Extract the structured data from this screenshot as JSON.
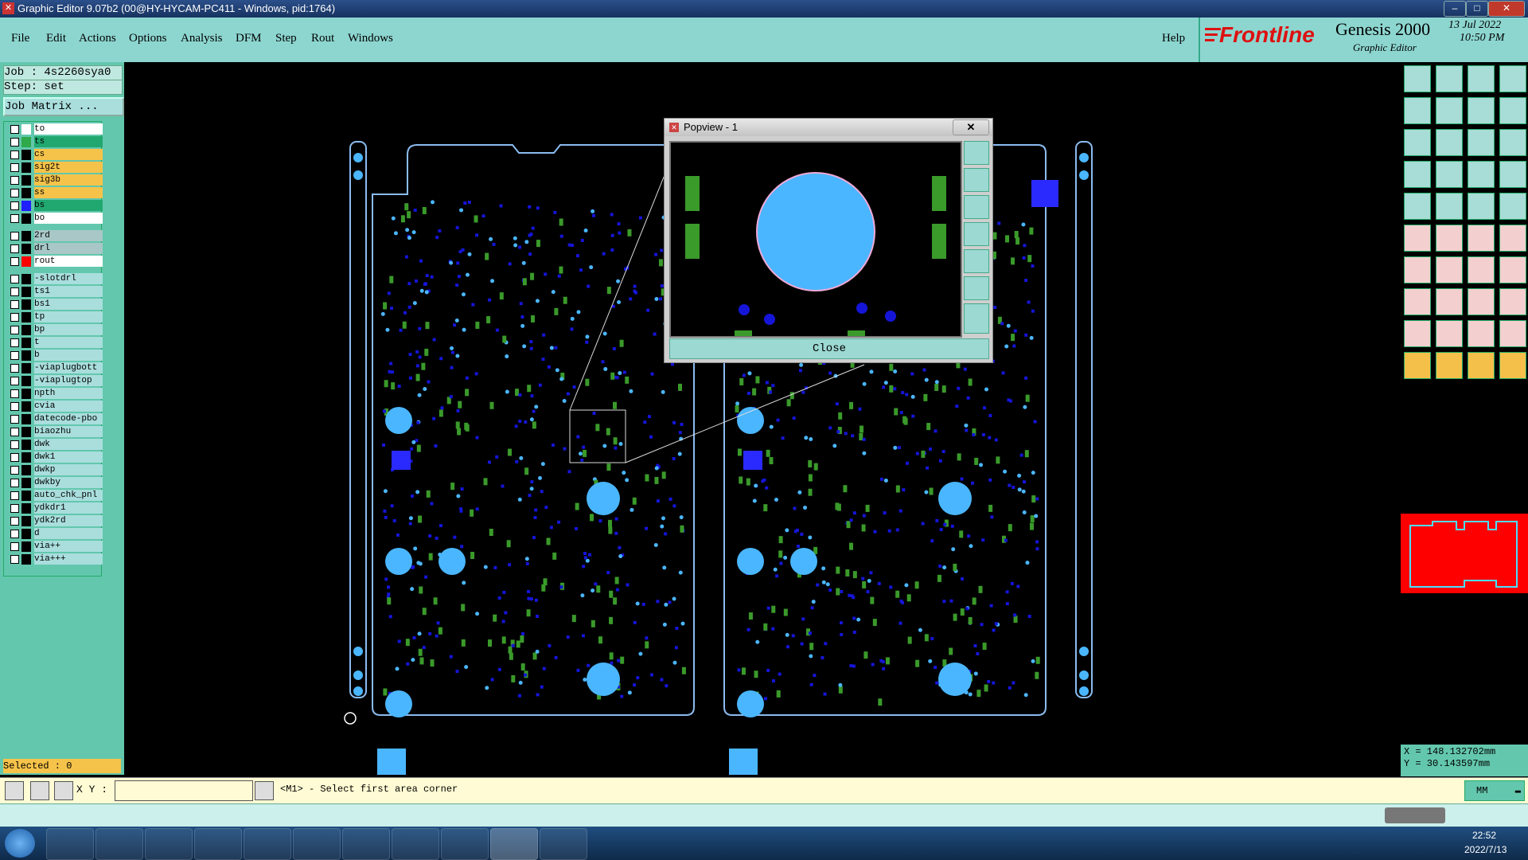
{
  "window": {
    "title": "Graphic Editor 9.07b2 (00@HY-HYCAM-PC411 - Windows, pid:1764)"
  },
  "menu": [
    "File",
    "Edit",
    "Actions",
    "Options",
    "Analysis",
    "DFM",
    "Step",
    "Rout",
    "Windows"
  ],
  "help_label": "Help",
  "brand": {
    "logo": "Frontline",
    "product": "Genesis 2000",
    "subtitle": "Graphic Editor",
    "date": "13 Jul 2022",
    "time": "10:50 PM"
  },
  "job": {
    "job_label": "Job : 4s2260sya0",
    "step_label": "Step: set",
    "matrix_button": "Job Matrix ..."
  },
  "layers": [
    {
      "name": "to",
      "color": "#ffffff",
      "bg": "#ffffff"
    },
    {
      "name": "ts",
      "color": "#2eaa4a",
      "bg": "#21a870"
    },
    {
      "name": "cs",
      "color": "#000000",
      "bg": "#f6c34a"
    },
    {
      "name": "sig2t",
      "color": "#000000",
      "bg": "#f6c34a"
    },
    {
      "name": "sig3b",
      "color": "#000000",
      "bg": "#f6c34a"
    },
    {
      "name": "ss",
      "color": "#000000",
      "bg": "#f6c34a"
    },
    {
      "name": "bs",
      "color": "#2020ff",
      "bg": "#21a870"
    },
    {
      "name": "bo",
      "color": "#000000",
      "bg": "#ffffff"
    },
    {
      "name": "2rd",
      "color": "#000000",
      "bg": "#a9c7c7"
    },
    {
      "name": "drl",
      "color": "#000000",
      "bg": "#a9c7c7"
    },
    {
      "name": "rout",
      "color": "#ff0000",
      "bg": "#ffffff"
    },
    {
      "name": "-slotdrl",
      "color": "#000000",
      "bg": "#a9dedd"
    },
    {
      "name": "ts1",
      "color": "#000000",
      "bg": "#a9dedd"
    },
    {
      "name": "bs1",
      "color": "#000000",
      "bg": "#a9dedd"
    },
    {
      "name": "tp",
      "color": "#000000",
      "bg": "#a9dedd"
    },
    {
      "name": "bp",
      "color": "#000000",
      "bg": "#a9dedd"
    },
    {
      "name": "t",
      "color": "#000000",
      "bg": "#a9dedd"
    },
    {
      "name": "b",
      "color": "#000000",
      "bg": "#a9dedd"
    },
    {
      "name": "-viaplugbott",
      "color": "#000000",
      "bg": "#a9dedd"
    },
    {
      "name": "-viaplugtop",
      "color": "#000000",
      "bg": "#a9dedd"
    },
    {
      "name": "npth",
      "color": "#000000",
      "bg": "#a9dedd"
    },
    {
      "name": "cvia",
      "color": "#000000",
      "bg": "#a9dedd"
    },
    {
      "name": "datecode-pbo",
      "color": "#000000",
      "bg": "#a9dedd"
    },
    {
      "name": "biaozhu",
      "color": "#000000",
      "bg": "#a9dedd"
    },
    {
      "name": "dwk",
      "color": "#000000",
      "bg": "#a9dedd"
    },
    {
      "name": "dwk1",
      "color": "#000000",
      "bg": "#a9dedd"
    },
    {
      "name": "dwkp",
      "color": "#000000",
      "bg": "#a9dedd"
    },
    {
      "name": "dwkby",
      "color": "#000000",
      "bg": "#a9dedd"
    },
    {
      "name": "auto_chk_pnl",
      "color": "#000000",
      "bg": "#a9dedd"
    },
    {
      "name": "ydkdr1",
      "color": "#000000",
      "bg": "#a9dedd"
    },
    {
      "name": "ydk2rd",
      "color": "#000000",
      "bg": "#a9dedd"
    },
    {
      "name": "d",
      "color": "#000000",
      "bg": "#a9dedd"
    },
    {
      "name": "via++",
      "color": "#000000",
      "bg": "#a9dedd"
    },
    {
      "name": "via+++",
      "color": "#000000",
      "bg": "#a9dedd"
    }
  ],
  "selected_label": "Selected : 0",
  "popview": {
    "title": "Popview - 1",
    "close_label": "Close"
  },
  "coords": {
    "x": "X = 148.132702mm",
    "y": "Y = 30.143597mm"
  },
  "command": {
    "xy_label": "X Y :",
    "xy_value": "",
    "prompt": "<M1> - Select first area corner",
    "units": "MM"
  },
  "taskbar": {
    "time": "22:52",
    "date": "2022/7/13"
  },
  "colors": {
    "board_outline": "#8bbcf0",
    "pad_light": "#4ab6ff",
    "pad_dark": "#1515d8",
    "pad_green": "#3a9a2a"
  }
}
